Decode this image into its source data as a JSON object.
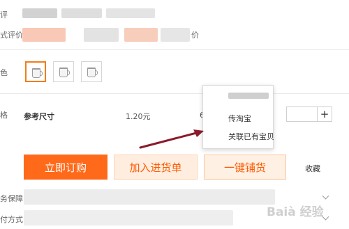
{
  "labels": {
    "row1": "评",
    "row2": "式评价",
    "row2_suffix": "价",
    "row3": "色",
    "row4": "格",
    "row5": "务保障",
    "row6": "付方式"
  },
  "spec_table": {
    "name": "参考尺寸",
    "price": "1.20元",
    "partial": "6"
  },
  "buttons": {
    "buy": "立即订购",
    "cart": "加入进货单",
    "distribute": "一键铺货",
    "favorite": "收藏"
  },
  "popup": {
    "items": [
      "传淘宝",
      "关联已有宝贝"
    ]
  },
  "quantity": {
    "plus": "+"
  },
  "watermark": "Baià 经验",
  "colors": {
    "accent": "#ff6a1a",
    "arrow": "#8b1a2b"
  }
}
